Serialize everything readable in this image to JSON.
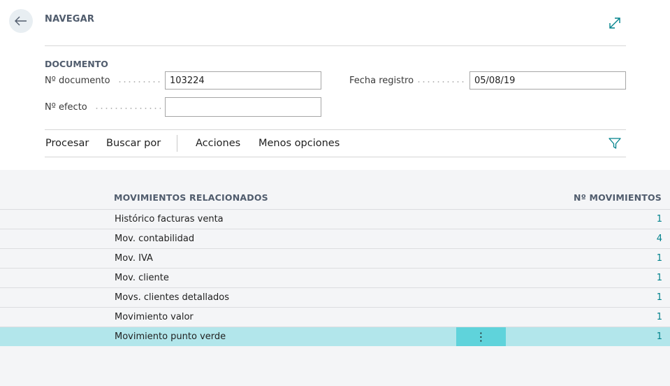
{
  "header": {
    "title": "NAVEGAR",
    "back_icon": "arrow-left-icon",
    "expand_icon": "expand-icon"
  },
  "document": {
    "section_title": "DOCUMENTO",
    "doc_no_label": "Nº documento",
    "doc_no_value": "103224",
    "posting_date_label": "Fecha registro",
    "posting_date_value": "05/08/19",
    "effect_no_label": "Nº efecto",
    "effect_no_value": ""
  },
  "actions": {
    "process": "Procesar",
    "find_by": "Buscar por",
    "actions": "Acciones",
    "fewer_options": "Menos opciones",
    "filter_icon": "filter-icon"
  },
  "list": {
    "col_name": "MOVIMIENTOS RELACIONADOS",
    "col_count": "Nº MOVIMIENTOS",
    "rows": [
      {
        "name": "Histórico facturas venta",
        "count": "1"
      },
      {
        "name": "Mov. contabilidad",
        "count": "4"
      },
      {
        "name": "Mov. IVA",
        "count": "1"
      },
      {
        "name": "Mov. cliente",
        "count": "1"
      },
      {
        "name": "Movs. clientes detallados",
        "count": "1"
      },
      {
        "name": "Movimiento valor",
        "count": "1"
      },
      {
        "name": "Movimiento punto verde",
        "count": "1"
      }
    ],
    "row_menu_glyph": "⋮",
    "colors": {
      "accent": "#00828c",
      "selected_row": "#b2e6eb",
      "row_menu": "#5fd3db"
    }
  }
}
